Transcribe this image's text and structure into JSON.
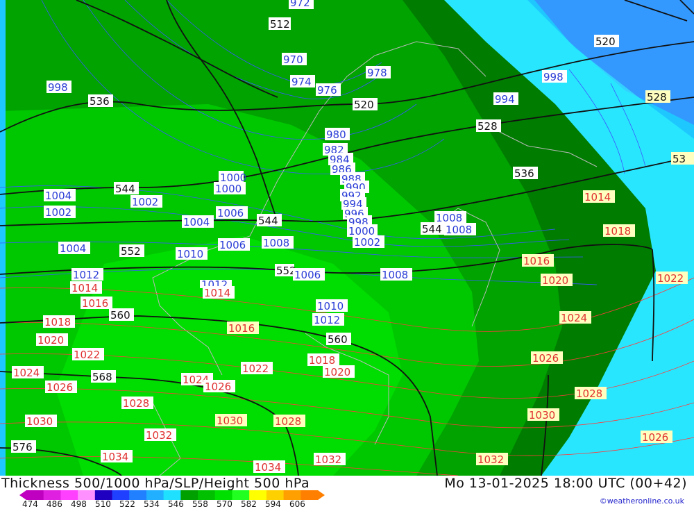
{
  "footer": {
    "title": "Thickness 500/1000 hPa/SLP/Height 500 hPa",
    "datetime": "Mo 13-01-2025 18:00 UTC (00+42)",
    "credit": "©weatheronline.co.uk",
    "legend": {
      "ticks": [
        "474",
        "486",
        "498",
        "510",
        "522",
        "534",
        "546",
        "558",
        "570",
        "582",
        "594",
        "606"
      ],
      "colors": [
        "#c000c0",
        "#e020e0",
        "#ff40ff",
        "#ff90ff",
        "#2000c0",
        "#2040ff",
        "#2080ff",
        "#20b0ff",
        "#20e0ff",
        "#00a000",
        "#00c000",
        "#00e000",
        "#20ff20",
        "#ffff00",
        "#ffd000",
        "#ffa000",
        "#ff8000"
      ]
    }
  },
  "map": {
    "fill_colors": {
      "cyan_light": "#33ffff",
      "cyan": "#1ec8ff",
      "blue": "#3399ff",
      "green_dark": "#007d00",
      "green": "#00a300",
      "green_light": "#00c800",
      "green_bright": "#00dd00"
    },
    "thickness_labels": [
      "512",
      "520",
      "520",
      "528",
      "528",
      "536",
      "536",
      "536",
      "544",
      "544",
      "544",
      "552",
      "552",
      "560",
      "560",
      "568",
      "576",
      "53"
    ],
    "slp_blue_labels": [
      "972",
      "970",
      "974",
      "976",
      "978",
      "998",
      "998",
      "994",
      "980",
      "982",
      "984",
      "986",
      "988",
      "990",
      "992",
      "994",
      "996",
      "998",
      "1000",
      "1000",
      "1000",
      "1004",
      "1002",
      "1002",
      "1006",
      "1004",
      "1008",
      "1008",
      "1004",
      "1006",
      "1008",
      "1010",
      "1012",
      "1012",
      "1006",
      "1010",
      "1012",
      "1008",
      "1002"
    ],
    "slp_red_labels": [
      "1014",
      "1016",
      "1018",
      "1020",
      "1022",
      "1024",
      "1026",
      "1028",
      "1030",
      "1032",
      "1034",
      "1014",
      "1016",
      "1018",
      "1020",
      "1022",
      "1024",
      "1026",
      "1028",
      "1030",
      "1032",
      "1034",
      "1014",
      "1016",
      "1018",
      "1020",
      "1022",
      "1024",
      "1026",
      "1028",
      "1030",
      "1032",
      "1026"
    ]
  }
}
